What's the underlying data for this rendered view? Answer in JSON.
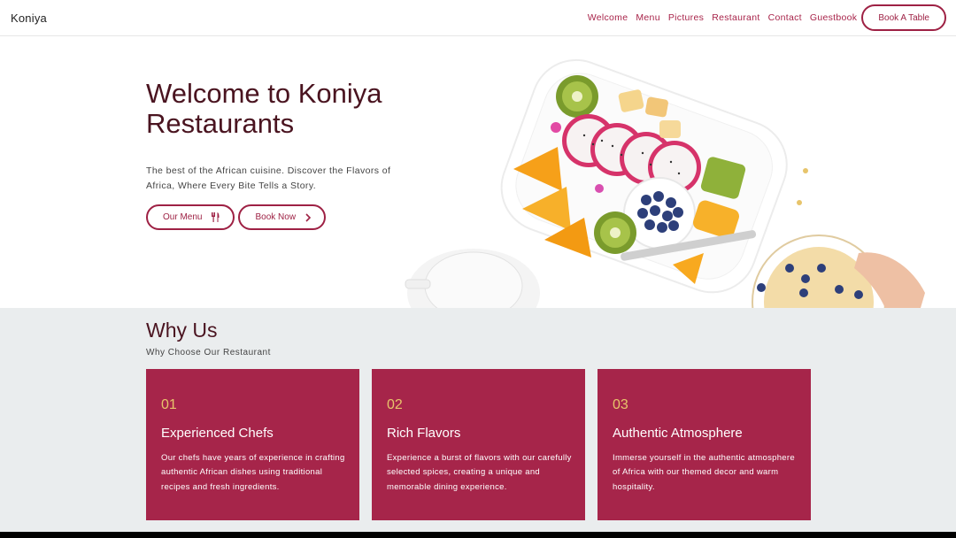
{
  "brand": "Koniya",
  "nav": {
    "links": [
      "Welcome",
      "Menu",
      "Pictures",
      "Restaurant",
      "Contact",
      "Guestbook"
    ],
    "cta": "Book A Table"
  },
  "hero": {
    "title": "Welcome to Koniya Restaurants",
    "subtitle": "The best of the African cuisine. Discover the Flavors of Africa, Where Every Bite Tells a Story.",
    "menu_button": "Our Menu",
    "menu_icon": "fork-knife-icon",
    "book_button": "Book Now",
    "book_icon": "chevron-right-icon"
  },
  "why": {
    "title": "Why Us",
    "subtitle": "Why Choose Our Restaurant",
    "cards": [
      {
        "number": "01",
        "title": "Experienced Chefs",
        "text": "Our chefs have years of experience in crafting authentic African dishes using traditional recipes and fresh ingredients."
      },
      {
        "number": "02",
        "title": "Rich Flavors",
        "text": "Experience a burst of flavors with our carefully selected spices, creating a unique and memorable dining experience."
      },
      {
        "number": "03",
        "title": "Authentic Atmosphere",
        "text": "Immerse yourself in the authentic atmosphere of Africa with our themed decor and warm hospitality."
      }
    ]
  },
  "colors": {
    "accent": "#a6254a",
    "heading": "#4a1420",
    "card_number": "#e7c46b",
    "section_bg": "#eaedee"
  }
}
